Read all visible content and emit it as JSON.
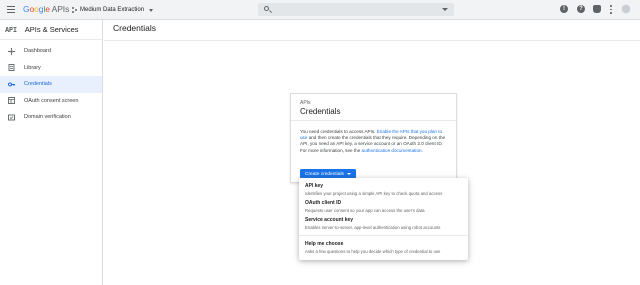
{
  "header": {
    "logo_google": "Google",
    "logo_apis": "APIs",
    "project_name": "Medium Data Extraction",
    "search_placeholder": ""
  },
  "sidebar": {
    "mark": "API",
    "title": "APIs & Services",
    "items": [
      {
        "label": "Dashboard",
        "icon": "dashboard-icon",
        "active": false
      },
      {
        "label": "Library",
        "icon": "library-icon",
        "active": false
      },
      {
        "label": "Credentials",
        "icon": "key-icon",
        "active": true
      },
      {
        "label": "OAuth consent screen",
        "icon": "consent-icon",
        "active": false
      },
      {
        "label": "Domain verification",
        "icon": "domain-icon",
        "active": false
      }
    ]
  },
  "main": {
    "title": "Credentials"
  },
  "card": {
    "kicker": "APIs",
    "title": "Credentials",
    "body_prefix": "You need credentials to access APIs. ",
    "body_link1": "Enable the APIs that you plan to use",
    "body_middle": " and then create the credentials that they require. Depending on the API, you need an API key, a service account or an OAuth 2.0 client ID. For more information, see the ",
    "body_link2": "authentication documentation",
    "body_suffix": ".",
    "button_label": "Create credentials"
  },
  "menu": {
    "items": [
      {
        "title": "API key",
        "desc": "Identifies your project using a simple API key to check quota and access"
      },
      {
        "title": "OAuth client ID",
        "desc": "Requests user consent so your app can access the user's data"
      },
      {
        "title": "Service account key",
        "desc": "Enables server-to-server, app-level authentication using robot accounts"
      },
      {
        "title": "Help me choose",
        "desc": "Asks a few questions to help you decide which type of credential to use"
      }
    ]
  },
  "colors": {
    "accent": "#1a73e8",
    "active_bg": "#e8f0fe",
    "topbar_bg": "#f1f3f4"
  }
}
